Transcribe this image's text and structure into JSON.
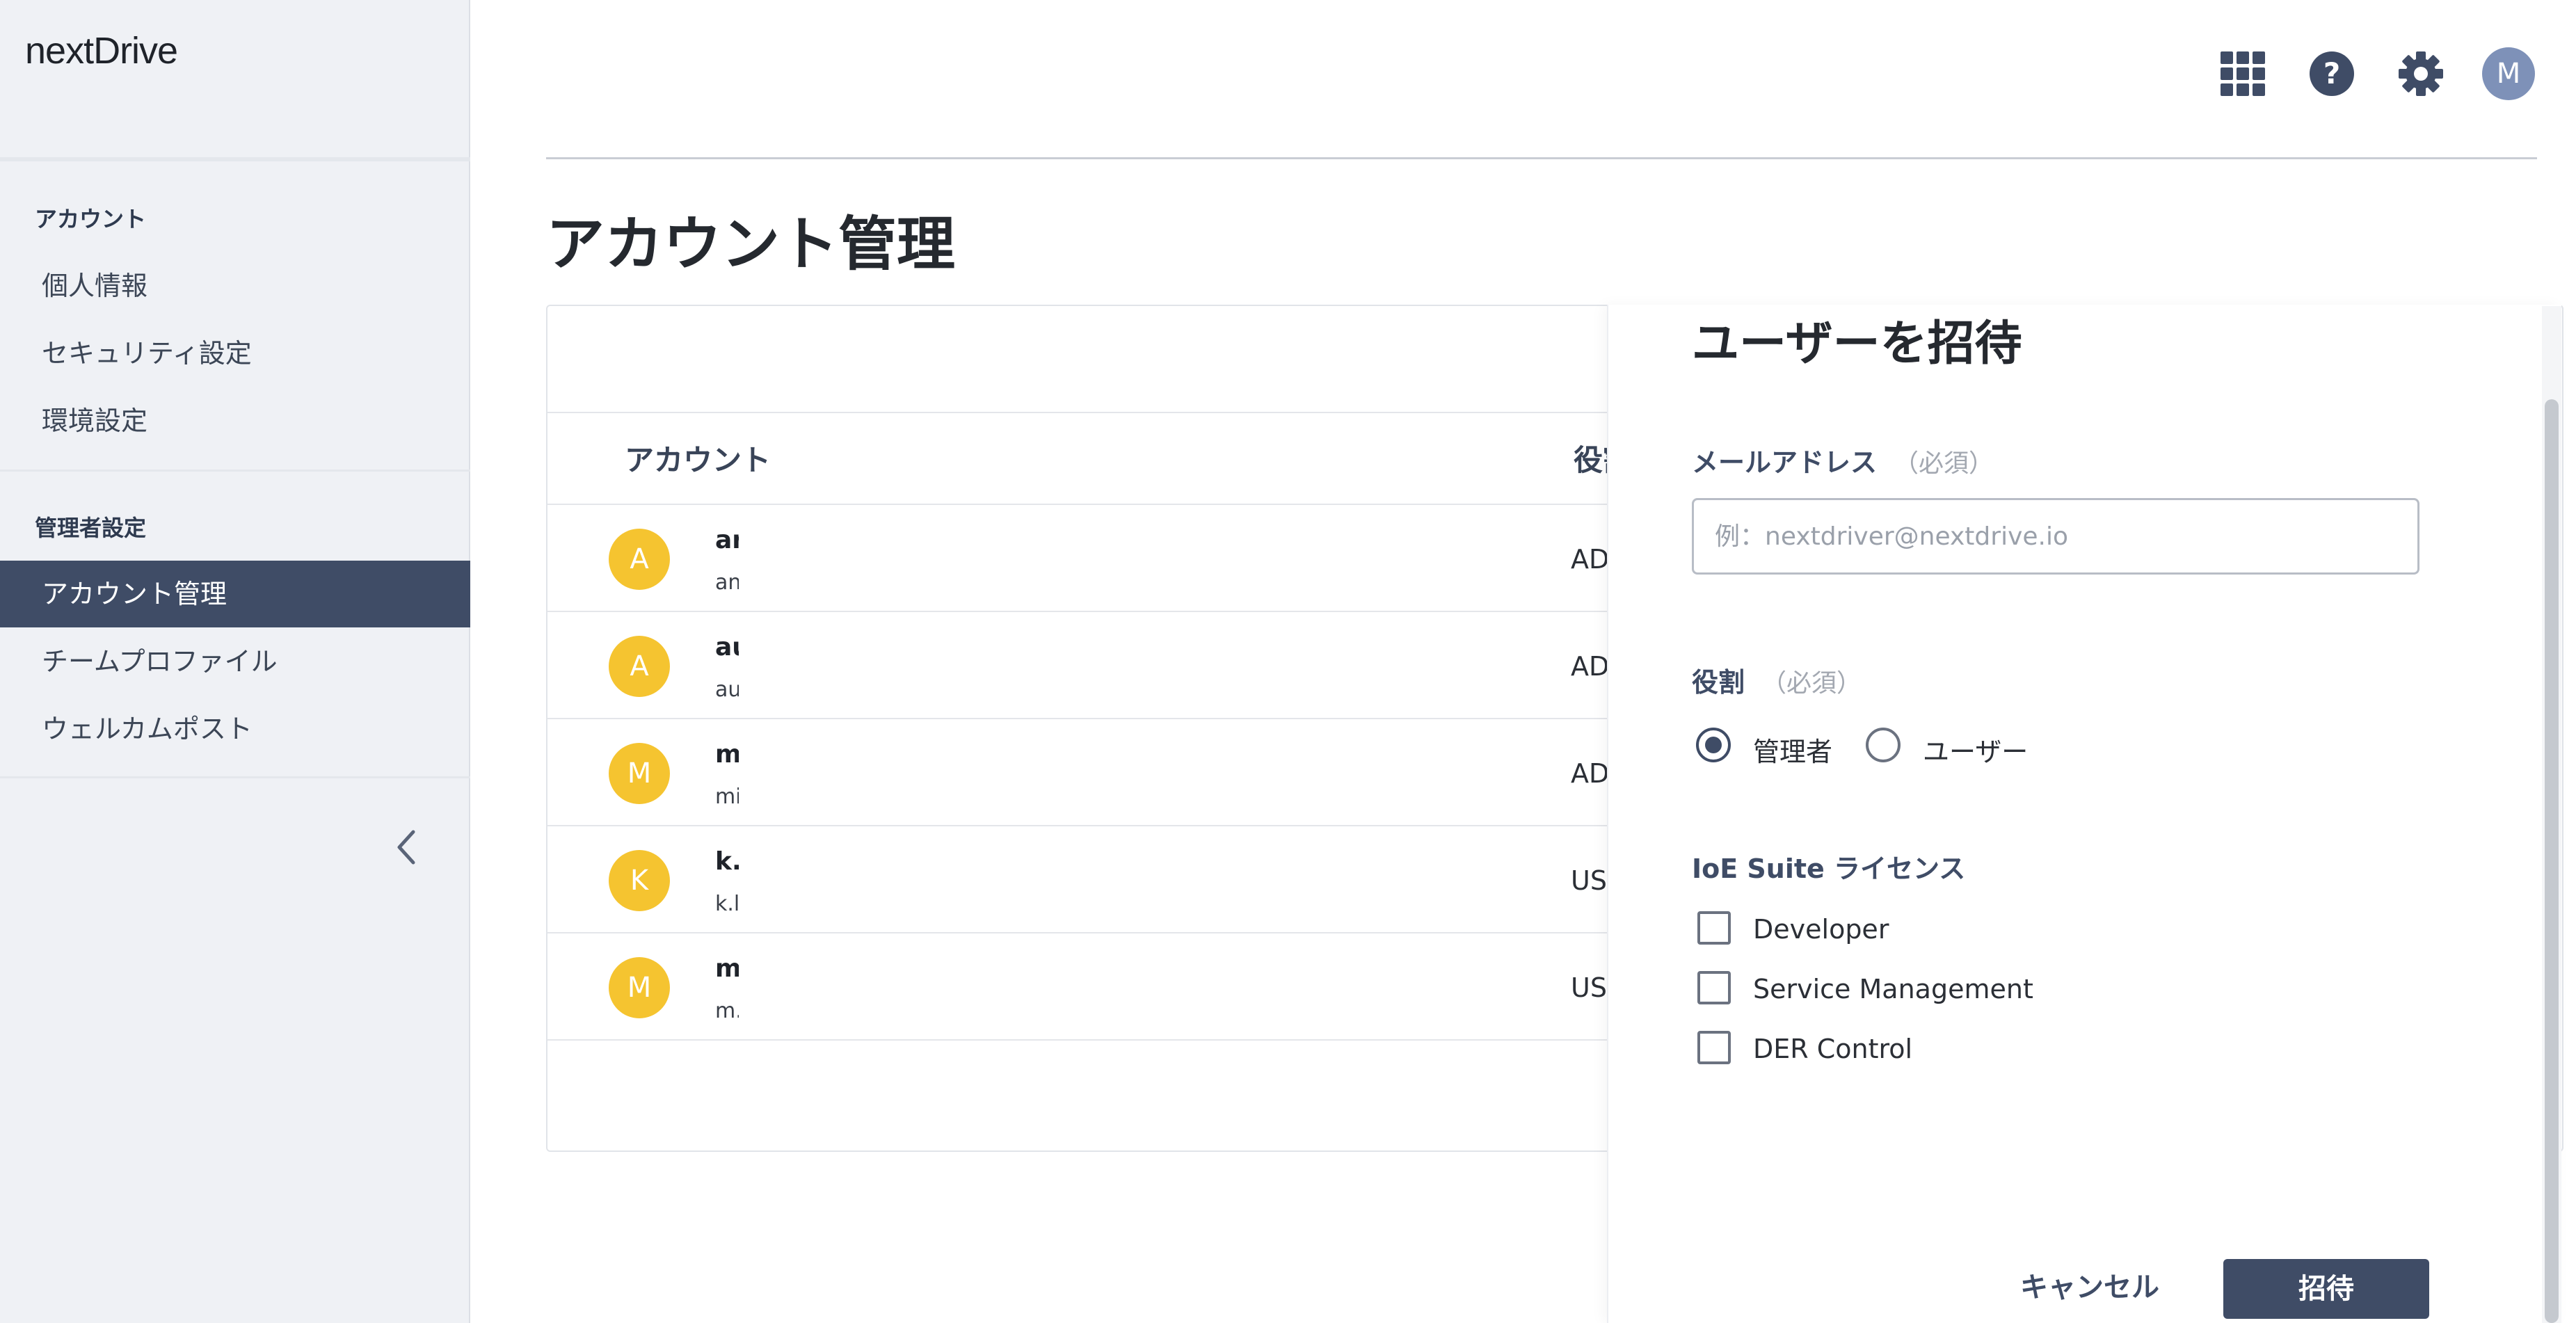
{
  "app": {
    "logo": "nextDrive"
  },
  "sidebar": {
    "sections": [
      {
        "heading": "アカウント",
        "items": [
          {
            "label": "個人情報"
          },
          {
            "label": "セキュリティ設定"
          },
          {
            "label": "環境設定"
          }
        ]
      },
      {
        "heading": "管理者設定",
        "items": [
          {
            "label": "アカウント管理",
            "active": true
          },
          {
            "label": "チームプロファイル"
          },
          {
            "label": "ウェルカムポスト"
          }
        ]
      }
    ],
    "collapse_icon": "chevron-left-icon"
  },
  "topbar": {
    "icons": [
      "apps-grid-icon",
      "help-icon",
      "gear-icon"
    ],
    "avatar_letter": "M"
  },
  "main": {
    "title": "アカウント管理",
    "table": {
      "columns": [
        "アカウント",
        "役割"
      ],
      "rows": [
        {
          "avatar": "A",
          "name": "ar",
          "email": "an",
          "role": "AD"
        },
        {
          "avatar": "A",
          "name": "au",
          "email": "au",
          "role": "AD"
        },
        {
          "avatar": "M",
          "name": "m",
          "email": "mi",
          "role": "AD"
        },
        {
          "avatar": "K",
          "name": "k.l",
          "email": "k.l",
          "role": "USI"
        },
        {
          "avatar": "M",
          "name": "m",
          "email": "m.",
          "role": "USI"
        }
      ]
    }
  },
  "invite_panel": {
    "title": "ユーザーを招待",
    "email": {
      "label": "メールアドレス",
      "required": "（必須）",
      "placeholder": "例：nextdriver@nextdrive.io",
      "value": ""
    },
    "role": {
      "label": "役割",
      "required": "（必須）",
      "options": [
        {
          "label": "管理者",
          "checked": true
        },
        {
          "label": "ユーザー",
          "checked": false
        }
      ]
    },
    "license": {
      "label": "IoE Suite ライセンス",
      "options": [
        {
          "label": "Developer",
          "checked": false
        },
        {
          "label": "Service Management",
          "checked": false
        },
        {
          "label": "DER Control",
          "checked": false
        }
      ]
    },
    "cancel_label": "キャンセル",
    "invite_label": "招待"
  },
  "colors": {
    "primary": "#3f4c66",
    "avatar_yellow": "#f5c430",
    "avatar_user": "#7e91b8",
    "sidebar_bg": "#eff1f5"
  }
}
